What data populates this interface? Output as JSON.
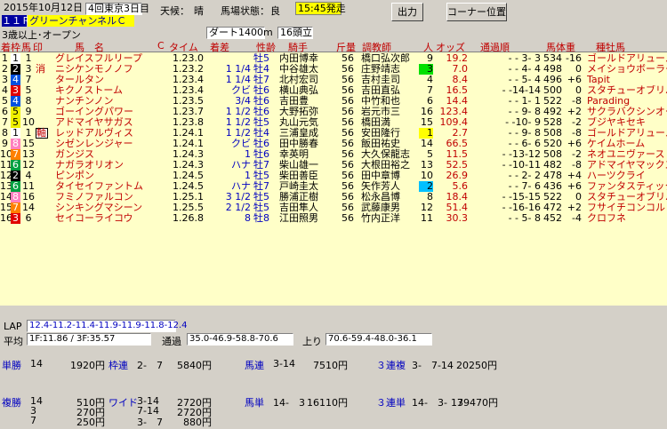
{
  "top": {
    "date": "2015年10月12日",
    "meeting": "4回東京3日目",
    "weather_label": "天候：",
    "weather": "晴",
    "track_label": "馬場状態：",
    "track": "良",
    "start_time": "15:45発走",
    "race_no": "１１Ｒ",
    "race_name": "グリーンチャンネルＣ",
    "condition": "3歳以上･オープン",
    "course": "ダート1400m",
    "runners": "16頭立",
    "btn_output": "出力",
    "btn_corner": "コーナー位置"
  },
  "columns": [
    "着",
    "枠",
    "馬",
    "印",
    "馬　名",
    "C",
    "タイム",
    "着差",
    "性齢",
    "騎手",
    "斤量",
    "調教師",
    "人",
    "オッズ",
    "通過順",
    "馬体重",
    "種牡馬"
  ],
  "rows": [
    {
      "pos": "1",
      "waku": "1",
      "uma": "1",
      "mark": "",
      "name": "グレイスフルリープ",
      "time": "1.23.0",
      "margin": "",
      "sexage": "牡5",
      "jockey": "内田博幸",
      "kin": "56",
      "trainer": "橋口弘次郎",
      "pop": "9",
      "odds": "19.2",
      "pass": "-  -  3-  3",
      "wt": "534",
      "diff": "-16",
      "sire": "ゴールドアリュール"
    },
    {
      "pos": "2",
      "waku": "2",
      "uma": "3",
      "mark": "消",
      "name": "ニシケンモノノフ",
      "time": "1.23.2",
      "margin": "1  1/4",
      "sexage": "牡4",
      "jockey": "中谷雄太",
      "kin": "56",
      "trainer": "庄野靖志",
      "pop": "3",
      "odds": "7.0",
      "pass": "-  -  4-  4",
      "wt": "498",
      "diff": "0",
      "sire": "メイショウボーラー"
    },
    {
      "pos": "3",
      "waku": "4",
      "uma": "7",
      "mark": "",
      "name": "タールタン",
      "time": "1.23.4",
      "margin": "1  1/4",
      "sexage": "牡7",
      "jockey": "北村宏司",
      "kin": "56",
      "trainer": "吉村圭司",
      "pop": "4",
      "odds": "8.4",
      "pass": "-  -  5-  4",
      "wt": "496",
      "diff": "+6",
      "sire": "Tapit"
    },
    {
      "pos": "4",
      "waku": "3",
      "uma": "5",
      "mark": "",
      "name": "キクノストーム",
      "time": "1.23.4",
      "margin": "クビ",
      "sexage": "牡6",
      "jockey": "横山典弘",
      "kin": "56",
      "trainer": "吉田直弘",
      "pop": "7",
      "odds": "16.5",
      "pass": "- -14-14",
      "wt": "500",
      "diff": "0",
      "sire": "スタチューオブリバティ"
    },
    {
      "pos": "5",
      "waku": "4",
      "uma": "8",
      "mark": "",
      "name": "ナンチンノン",
      "time": "1.23.5",
      "margin": "3/4",
      "sexage": "牡6",
      "jockey": "吉田豊",
      "kin": "56",
      "trainer": "中竹和也",
      "pop": "6",
      "odds": "14.4",
      "pass": "-  -  1-  1",
      "wt": "522",
      "diff": "-8",
      "sire": "Parading"
    },
    {
      "pos": "6",
      "waku": "5",
      "uma": "9",
      "mark": "",
      "name": "ゴーイングパワー",
      "time": "1.23.7",
      "margin": "1  1/2",
      "sexage": "牡6",
      "jockey": "大野拓弥",
      "kin": "56",
      "trainer": "岩元市三",
      "pop": "16",
      "odds": "123.4",
      "pass": "-  -  9-  8",
      "wt": "492",
      "diff": "+2",
      "sire": "サクラバクシンオー"
    },
    {
      "pos": "7",
      "waku": "5",
      "uma": "10",
      "mark": "",
      "name": "アドマイヤサガス",
      "time": "1.23.8",
      "margin": "1  1/2",
      "sexage": "牡5",
      "jockey": "丸山元気",
      "kin": "56",
      "trainer": "橋田満",
      "pop": "15",
      "odds": "109.4",
      "pass": "-  -10-  9",
      "wt": "528",
      "diff": "-2",
      "sire": "ブジヤキセキ"
    },
    {
      "pos": "8",
      "waku": "1",
      "uma": "1",
      "mark": "軸",
      "name": "レッドアルヴィス",
      "time": "1.24.1",
      "margin": "1  1/2",
      "sexage": "牡4",
      "jockey": "三浦皇成",
      "kin": "56",
      "trainer": "安田隆行",
      "pop": "1",
      "odds": "2.7",
      "pass": "-  -  9-  8",
      "wt": "508",
      "diff": "-8",
      "sire": "ゴールドアリュール"
    },
    {
      "pos": "9",
      "waku": "8",
      "uma": "15",
      "mark": "",
      "name": "シゼンレンジャー",
      "time": "1.24.1",
      "margin": "クビ",
      "sexage": "牡6",
      "jockey": "田中勝春",
      "kin": "56",
      "trainer": "飯田祐史",
      "pop": "14",
      "odds": "66.5",
      "pass": "-  -  6-  6",
      "wt": "520",
      "diff": "+6",
      "sire": "ケイムホーム"
    },
    {
      "pos": "10",
      "waku": "7",
      "uma": "13",
      "mark": "",
      "name": "ガンジス",
      "time": "1.24.3",
      "margin": "1",
      "sexage": "牡6",
      "jockey": "幸英明",
      "kin": "56",
      "trainer": "大久保龍志",
      "pop": "5",
      "odds": "11.5",
      "pass": "- -13-12",
      "wt": "508",
      "diff": "-2",
      "sire": "ネオユニヴァース"
    },
    {
      "pos": "11",
      "waku": "6",
      "uma": "12",
      "mark": "",
      "name": "ナガラオリオン",
      "time": "1.24.3",
      "margin": "ハナ",
      "sexage": "牡7",
      "jockey": "柴山雄一",
      "kin": "56",
      "trainer": "大根田裕之",
      "pop": "13",
      "odds": "52.5",
      "pass": "- -10-11",
      "wt": "482",
      "diff": "-8",
      "sire": "アドマイヤマックス"
    },
    {
      "pos": "12",
      "waku": "2",
      "uma": "4",
      "mark": "",
      "name": "ピンポン",
      "time": "1.24.5",
      "margin": "1",
      "sexage": "牡5",
      "jockey": "柴田善臣",
      "kin": "56",
      "trainer": "田中章博",
      "pop": "10",
      "odds": "26.9",
      "pass": "-  -  2-  2",
      "wt": "478",
      "diff": "+4",
      "sire": "ハーツクライ"
    },
    {
      "pos": "13",
      "waku": "6",
      "uma": "11",
      "mark": "",
      "name": "タイセイファントム",
      "time": "1.24.5",
      "margin": "ハナ",
      "sexage": "牡7",
      "jockey": "戸崎圭太",
      "kin": "56",
      "trainer": "矢作芳人",
      "pop": "2",
      "odds": "5.6",
      "pass": "-  -  7-  6",
      "wt": "436",
      "diff": "+6",
      "sire": "ファンタスティックライト"
    },
    {
      "pos": "14",
      "waku": "8",
      "uma": "16",
      "mark": "",
      "name": "フミノファルコン",
      "time": "1.25.1",
      "margin": "3  1/2",
      "sexage": "牡5",
      "jockey": "勝浦正樹",
      "kin": "56",
      "trainer": "松永昌博",
      "pop": "8",
      "odds": "18.4",
      "pass": "- -15-15",
      "wt": "522",
      "diff": "0",
      "sire": "スタチューオブリバティ"
    },
    {
      "pos": "15",
      "waku": "7",
      "uma": "14",
      "mark": "",
      "name": "シンキングマシーン",
      "time": "1.25.5",
      "margin": "2  1/2",
      "sexage": "牡5",
      "jockey": "吉田隼人",
      "kin": "56",
      "trainer": "武藤康男",
      "pop": "12",
      "odds": "51.4",
      "pass": "- -16-16",
      "wt": "472",
      "diff": "+2",
      "sire": "フサイチコンコルド"
    },
    {
      "pos": "16",
      "waku": "3",
      "uma": "6",
      "mark": "",
      "name": "セイコーライコウ",
      "time": "1.26.8",
      "margin": "8",
      "sexage": "牡8",
      "jockey": "江田照男",
      "kin": "56",
      "trainer": "竹内正洋",
      "pop": "11",
      "odds": "30.3",
      "pass": "-  -  5-  8",
      "wt": "452",
      "diff": "-4",
      "sire": "クロフネ"
    }
  ],
  "lap": {
    "lap_label": "LAP",
    "lap": "12.4-11.2-11.4-11.9-11.9-11.8-12.4",
    "avg_label": "平均",
    "avg": "1F:11.86 / 3F:35.57",
    "pass_label": "通過",
    "pass": "35.0-46.9-58.8-70.6",
    "up_label": "上り",
    "up": "70.6-59.4-48.0-36.1"
  },
  "payouts": {
    "tansho": {
      "label": "単勝",
      "rows": [
        [
          "14",
          "1920円"
        ]
      ]
    },
    "wakuren": {
      "label": "枠連",
      "rows": [
        [
          "2-　7",
          "5840円"
        ]
      ]
    },
    "umaren": {
      "label": "馬連",
      "rows": [
        [
          "3-14",
          "7510円"
        ]
      ]
    },
    "sanrenpuku": {
      "label": "３連複",
      "rows": [
        [
          "3-　7-14",
          "20250円"
        ]
      ]
    },
    "fukusho": {
      "label": "複勝",
      "rows": [
        [
          "14",
          "510円"
        ],
        [
          "3",
          "270円"
        ],
        [
          "7",
          "250円"
        ]
      ]
    },
    "wide": {
      "label": "ワイド",
      "rows": [
        [
          "3-14",
          "2720円"
        ],
        [
          "7-14",
          "2720円"
        ],
        [
          "3-　7",
          "880円"
        ]
      ]
    },
    "umatan": {
      "label": "馬単",
      "rows": [
        [
          "14-　3",
          "16110円"
        ]
      ]
    },
    "sanrentan": {
      "label": "３連単",
      "rows": [
        [
          "14-　3-　7",
          "139470円"
        ]
      ]
    }
  },
  "colors": {
    "w1": "#ffffff",
    "w2": "#000000",
    "w3": "#e00000",
    "w4": "#0050e0",
    "w5": "#f0f000",
    "w6": "#00a040",
    "w7": "#ff8000",
    "w8": "#ff80c0"
  }
}
